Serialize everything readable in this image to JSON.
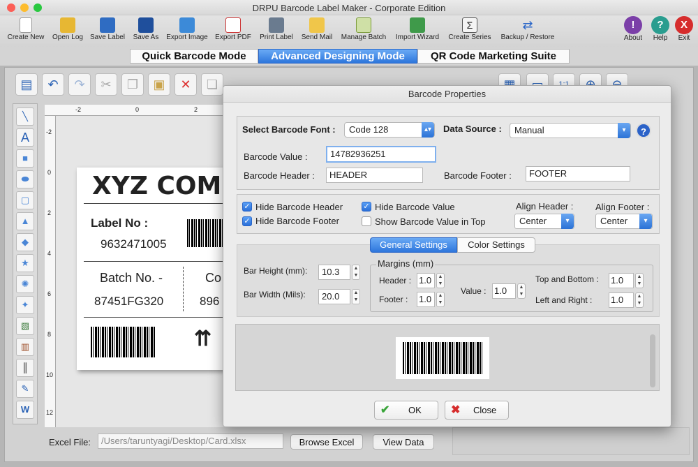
{
  "window": {
    "title": "DRPU Barcode Label Maker - Corporate Edition"
  },
  "toolbar": {
    "items": [
      {
        "label": "Create New",
        "icon": "new-file-icon"
      },
      {
        "label": "Open Log",
        "icon": "open-folder-icon"
      },
      {
        "label": "Save Label",
        "icon": "save-icon"
      },
      {
        "label": "Save As",
        "icon": "save-as-icon"
      },
      {
        "label": "Export Image",
        "icon": "export-image-icon"
      },
      {
        "label": "Export PDF",
        "icon": "pdf-icon"
      },
      {
        "label": "Print Label",
        "icon": "printer-icon"
      },
      {
        "label": "Send Mail",
        "icon": "mail-icon"
      },
      {
        "label": "Manage Batch",
        "icon": "batch-icon"
      },
      {
        "label": "Import Wizard",
        "icon": "import-wizard-icon"
      },
      {
        "label": "Create Series",
        "icon": "sigma-icon"
      },
      {
        "label": "Backup / Restore",
        "icon": "backup-restore-icon"
      }
    ],
    "about": "About",
    "help": "Help",
    "exit": "Exit"
  },
  "modes": [
    "Quick Barcode Mode",
    "Advanced Designing Mode",
    "QR Code Marketing Suite"
  ],
  "label_preview": {
    "company": "XYZ COMPA",
    "label_no_title": "Label No :",
    "label_no_value": "9632471005",
    "batch_title": "Batch No. -",
    "batch_value": "87451FG320",
    "col3_title": "Co",
    "col3_value": "896"
  },
  "ruler": {
    "h_ticks": [
      "-2",
      "0",
      "2"
    ],
    "v_ticks": [
      "-2",
      "0",
      "2",
      "4",
      "6",
      "8",
      "10",
      "12"
    ]
  },
  "excel": {
    "label": "Excel File:",
    "path": "/Users/taruntyagi/Desktop/Card.xlsx",
    "browse": "Browse Excel",
    "view": "View Data"
  },
  "dialog": {
    "title": "Barcode Properties",
    "select_font_label": "Select Barcode Font :",
    "font_value": "Code 128",
    "data_source_label": "Data Source :",
    "data_source_value": "Manual",
    "help_glyph": "?",
    "value_label": "Barcode Value :",
    "value": "14782936251",
    "header_label": "Barcode Header :",
    "header_value": "HEADER",
    "footer_label": "Barcode Footer :",
    "footer_value": "FOOTER",
    "hide_header": "Hide Barcode Header",
    "hide_footer": "Hide Barcode Footer",
    "hide_value": "Hide Barcode Value",
    "show_value_top": "Show Barcode Value in Top",
    "align_header_label": "Align Header :",
    "align_header_value": "Center",
    "align_footer_label": "Align Footer :",
    "align_footer_value": "Center",
    "tab_general": "General Settings",
    "tab_color": "Color Settings",
    "bar_height_label": "Bar Height (mm):",
    "bar_height_value": "10.3",
    "bar_width_label": "Bar Width (Mils):",
    "bar_width_value": "20.0",
    "margins_title": "Margins (mm)",
    "m_header_label": "Header :",
    "m_header_value": "1.0",
    "m_footer_label": "Footer :",
    "m_footer_value": "1.0",
    "m_value_label": "Value :",
    "m_value_value": "1.0",
    "m_tb_label": "Top and Bottom :",
    "m_tb_value": "1.0",
    "m_lr_label": "Left and Right :",
    "m_lr_value": "1.0",
    "ok": "OK",
    "close": "Close"
  },
  "colors": {
    "accent": "#2b72d6",
    "about": "#7b3fa8",
    "help": "#2a9d8f",
    "exit": "#d62d2d"
  }
}
